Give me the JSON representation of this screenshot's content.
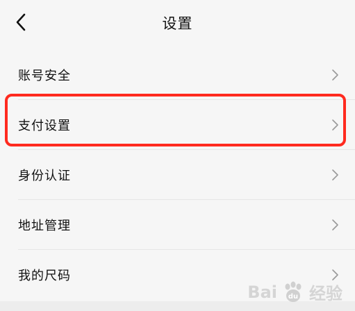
{
  "header": {
    "title": "设置",
    "back_icon": "chevron-left-icon"
  },
  "settings": {
    "items": [
      {
        "label": "账号安全"
      },
      {
        "label": "支付设置"
      },
      {
        "label": "身份认证"
      },
      {
        "label": "地址管理"
      },
      {
        "label": "我的尺码"
      }
    ]
  },
  "highlight": {
    "item": "支付设置",
    "color": "#ff2a1f"
  },
  "watermark": {
    "text": "Bai",
    "text2": "经验",
    "icon": "paw-logo-icon"
  }
}
